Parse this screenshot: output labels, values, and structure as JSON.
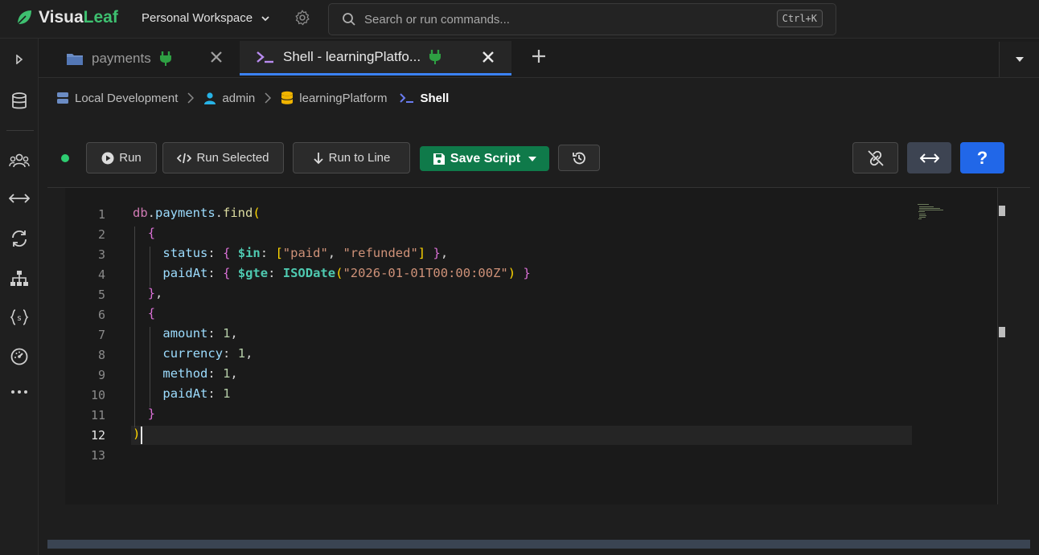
{
  "app": {
    "name_part1": "Visua",
    "name_part2": "Leaf"
  },
  "workspace": {
    "label": "Personal Workspace"
  },
  "search": {
    "placeholder": "Search or run commands...",
    "shortcut": "Ctrl+K"
  },
  "tabs": [
    {
      "label": "payments",
      "icon": "folder-icon"
    },
    {
      "label": "Shell - learningPlatfo...",
      "icon": "terminal-icon",
      "active": true
    }
  ],
  "breadcrumb": [
    {
      "label": "Local Development",
      "icon": "server-icon"
    },
    {
      "label": "admin",
      "icon": "user-icon"
    },
    {
      "label": "learningPlatform",
      "icon": "database-icon"
    },
    {
      "label": "Shell",
      "icon": "terminal-icon"
    }
  ],
  "toolbar": {
    "run": "Run",
    "run_selected": "Run Selected",
    "run_to_line": "Run to Line",
    "save_script": "Save Script",
    "help": "?"
  },
  "editor": {
    "line_numbers": [
      "1",
      "2",
      "3",
      "4",
      "5",
      "6",
      "7",
      "8",
      "9",
      "10",
      "11",
      "12",
      "13"
    ],
    "current_line": 12,
    "lines": [
      "db.payments.find(",
      "  {",
      "    status: { $in: [\"paid\", \"refunded\"] },",
      "    paidAt: { $gte: ISODate(\"2026-01-01T00:00:00Z\") }",
      "  },",
      "  {",
      "    amount: 1,",
      "    currency: 1,",
      "    method: 1,",
      "    paidAt: 1",
      "  }",
      ")",
      ""
    ]
  },
  "colors": {
    "brand": "#3ec070",
    "accent_tab": "#3b82f6",
    "save_button": "#0f7a4a",
    "help_button": "#2167e8",
    "connected_dot": "#2ecc71"
  }
}
